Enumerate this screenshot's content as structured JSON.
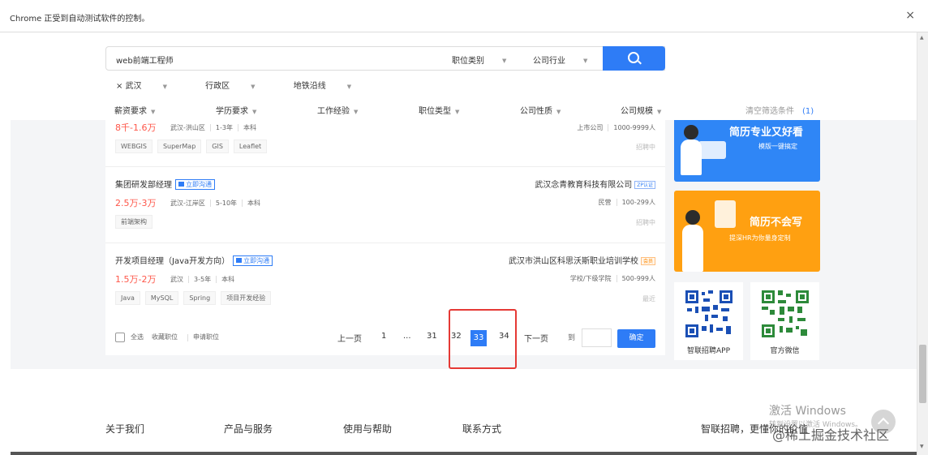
{
  "browser": {
    "infobar_text": "Chrome 正受到自动测试软件的控制。",
    "close_glyph": "×"
  },
  "search": {
    "query": "web前端工程师",
    "job_category": "职位类别",
    "company_industry": "公司行业"
  },
  "location": {
    "city": "× 武汉",
    "district": "行政区",
    "metro": "地铁沿线"
  },
  "filters": {
    "salary": "薪资要求",
    "education": "学历要求",
    "experience": "工作经验",
    "job_type": "职位类型",
    "company_nature": "公司性质",
    "company_size": "公司规模",
    "clear": "清空筛选条件",
    "clear_count": "(1)"
  },
  "jobs": [
    {
      "title": "",
      "salary": "8千-1.6万",
      "location": "武汉-洪山区",
      "experience": "1-3年",
      "education": "本科",
      "tags": [
        "WEBGIS",
        "SuperMap",
        "GIS",
        "Leaflet"
      ],
      "company": "",
      "company_type": "上市公司",
      "company_size": "1000-9999人",
      "status": "招聘中"
    },
    {
      "title": "集团研发部经理",
      "chat": "立即沟通",
      "salary": "2.5万-3万",
      "location": "武汉-江岸区",
      "experience": "5-10年",
      "education": "本科",
      "tags": [
        "前端架构"
      ],
      "company": "武汉念青教育科技有限公司",
      "company_badge": "ZP认证",
      "company_type": "民营",
      "company_size": "100-299人",
      "status": "招聘中"
    },
    {
      "title": "开发项目经理（Java开发方向）",
      "chat": "立即沟通",
      "salary": "1.5万-2万",
      "location": "武汉",
      "experience": "3-5年",
      "education": "本科",
      "tags": [
        "Java",
        "MySQL",
        "Spring",
        "项目开发经验"
      ],
      "company": "武汉市洪山区科思沃斯职业培训学校",
      "company_badge": "会员",
      "company_type": "学校/下级学院",
      "company_size": "500-999人",
      "status": "最近"
    }
  ],
  "pager": {
    "select_all": "全选",
    "favorite": "收藏职位",
    "apply": "申请职位",
    "prev": "上一页",
    "pages": [
      "1",
      "...",
      "31",
      "32",
      "33",
      "34"
    ],
    "current": "33",
    "next": "下一页",
    "goto": "到",
    "confirm": "确定"
  },
  "ads": {
    "resume_title": "简历专业又好看",
    "resume_sub": "模版一键搞定",
    "write_title": "简历不会写",
    "write_sub": "提深HR为你量身定制",
    "app_label": "智联招聘APP",
    "wechat_label": "官方微信"
  },
  "footer": {
    "about": "关于我们",
    "products": "产品与服务",
    "help": "使用与帮助",
    "contact": "联系方式",
    "slogan": "智联招聘，更懂你的价值"
  },
  "overlay": {
    "activate": "激活 Windows",
    "activate_sub": "转到设置以激活 Windows。",
    "juejin": "@稀土掘金技术社区"
  },
  "colors": {
    "accent": "#2e7cf6",
    "salary": "#fe574a",
    "highlight": "#e53935"
  }
}
